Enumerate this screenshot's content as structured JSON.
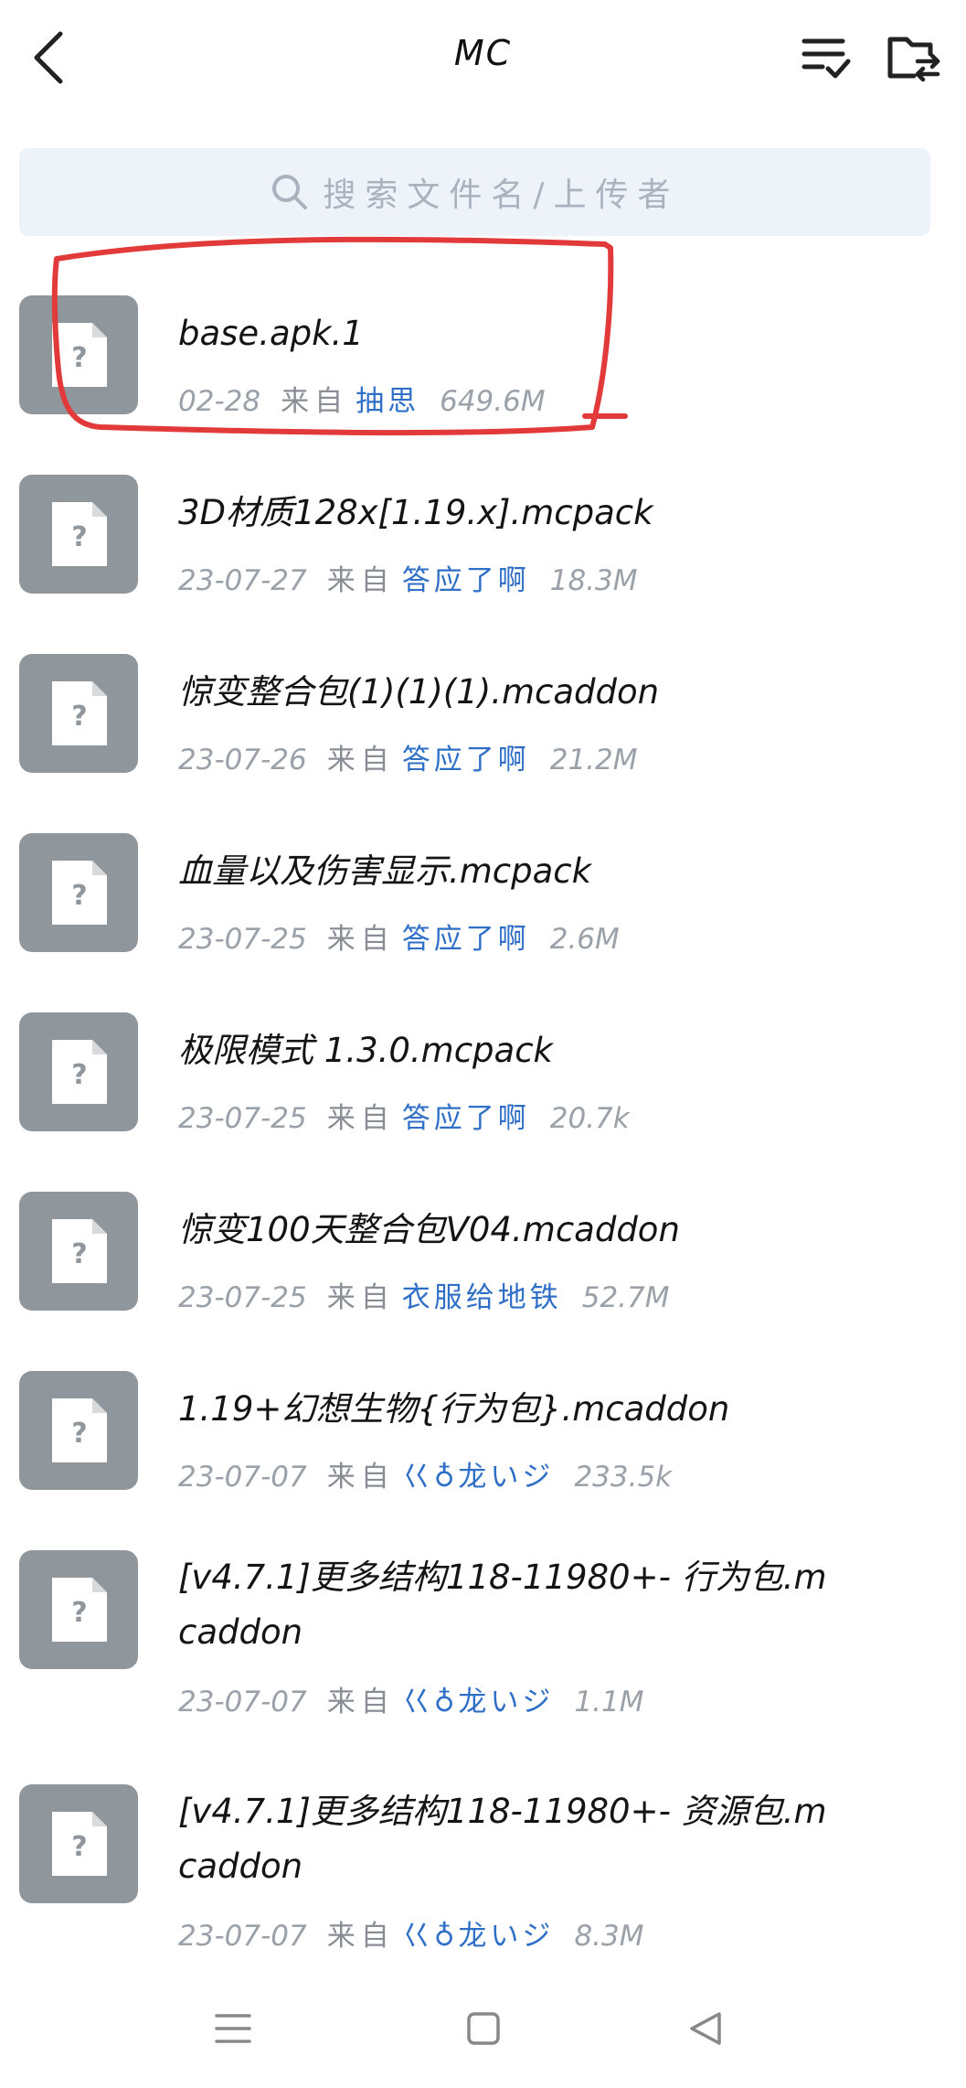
{
  "header": {
    "title": "MC",
    "back_icon": "chevron-left-icon",
    "select_icon": "multi-select-icon",
    "transfer_icon": "folder-transfer-icon"
  },
  "search": {
    "placeholder": "搜索文件名/上传者"
  },
  "files": [
    {
      "name": "base.apk.1",
      "date": "02-28",
      "from": "来自",
      "uploader": "抽思",
      "size": "649.6M"
    },
    {
      "name": "3D材质128x[1.19.x].mcpack",
      "date": "23-07-27",
      "from": "来自",
      "uploader": "答应了啊",
      "size": "18.3M"
    },
    {
      "name": "惊变整合包(1)(1)(1).mcaddon",
      "date": "23-07-26",
      "from": "来自",
      "uploader": "答应了啊",
      "size": "21.2M"
    },
    {
      "name": "血量以及伤害显示.mcpack",
      "date": "23-07-25",
      "from": "来自",
      "uploader": "答应了啊",
      "size": "2.6M"
    },
    {
      "name": "极限模式 1.3.0.mcpack",
      "date": "23-07-25",
      "from": "来自",
      "uploader": "答应了啊",
      "size": "20.7k"
    },
    {
      "name": "惊变100天整合包V04.mcaddon",
      "date": "23-07-25",
      "from": "来自",
      "uploader": "衣服给地铁",
      "size": "52.7M"
    },
    {
      "name": "1.19+幻想生物{行为包}.mcaddon",
      "date": "23-07-07",
      "from": "来自",
      "uploader": "巜♁龙いジ",
      "size": "233.5k"
    },
    {
      "name": "[v4.7.1]更多结构118-11980+- 行为包.mcaddon",
      "date": "23-07-07",
      "from": "来自",
      "uploader": "巜♁龙いジ",
      "size": "1.1M"
    },
    {
      "name": "[v4.7.1]更多结构118-11980+- 资源包.mcaddon",
      "date": "23-07-07",
      "from": "来自",
      "uploader": "巜♁龙いジ",
      "size": "8.3M"
    }
  ],
  "colors": {
    "accent": "#2f6fc7",
    "annotation": "#e23a3a",
    "thumb": "#8f969c",
    "search_bg": "#eef3fa"
  },
  "navbar": {
    "menu_icon": "menu-icon",
    "home_icon": "square-home-icon",
    "back_icon": "triangle-back-icon"
  }
}
